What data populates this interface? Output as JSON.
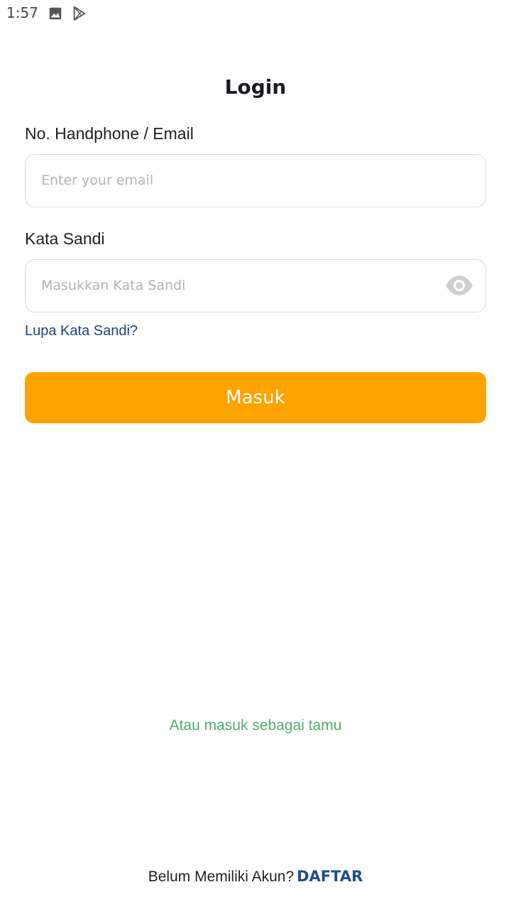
{
  "status_bar": {
    "time": "1:57",
    "icons": [
      "gallery-icon",
      "play-store-icon"
    ]
  },
  "page": {
    "title": "Login"
  },
  "form": {
    "email_label": "No. Handphone / Email",
    "email_placeholder": "Enter your email",
    "email_value": "",
    "password_label": "Kata Sandi",
    "password_placeholder": "Masukkan Kata Sandi",
    "password_value": "",
    "password_toggle_icon": "eye-icon",
    "forgot_password": "Lupa Kata Sandi?",
    "submit_label": "Masuk"
  },
  "guest_login": "Atau masuk sebagai tamu",
  "footer": {
    "prompt": "Belum Memiliki Akun?",
    "register_label": "DAFTAR"
  },
  "colors": {
    "primary_button": "#FFA300",
    "link_blue": "#21407A",
    "guest_green": "#4CAF6E",
    "register_blue": "#1E4D8C"
  }
}
